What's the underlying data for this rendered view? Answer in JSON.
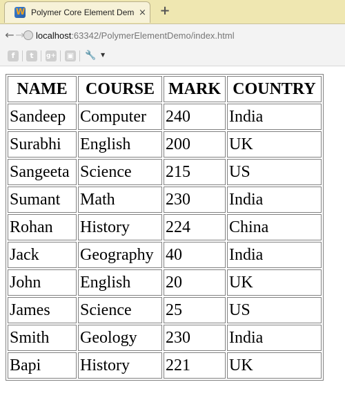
{
  "browser": {
    "tab": {
      "title": "Polymer Core Element Demo: ...",
      "close": "×"
    },
    "new_tab": "+",
    "address": {
      "host": "localhost",
      "rest": ":63342/PolymerElementDemo/index.html"
    },
    "bookmarks": [
      "facebook-icon",
      "twitter-icon",
      "google-plus-icon",
      "share-icon",
      "wrench-icon"
    ]
  },
  "table": {
    "headers": [
      "NAME",
      "COURSE",
      "MARK",
      "COUNTRY"
    ],
    "rows": [
      [
        "Sandeep",
        "Computer",
        "240",
        "India"
      ],
      [
        "Surabhi",
        "English",
        "200",
        "UK"
      ],
      [
        "Sangeeta",
        "Science",
        "215",
        "US"
      ],
      [
        "Sumant",
        "Math",
        "230",
        "India"
      ],
      [
        "Rohan",
        "History",
        "224",
        "China"
      ],
      [
        "Jack",
        "Geography",
        "40",
        "India"
      ],
      [
        "John",
        "English",
        "20",
        "UK"
      ],
      [
        "James",
        "Science",
        "25",
        "US"
      ],
      [
        "Smith",
        "Geology",
        "230",
        "India"
      ],
      [
        "Bapi",
        "History",
        "221",
        "UK"
      ]
    ]
  }
}
